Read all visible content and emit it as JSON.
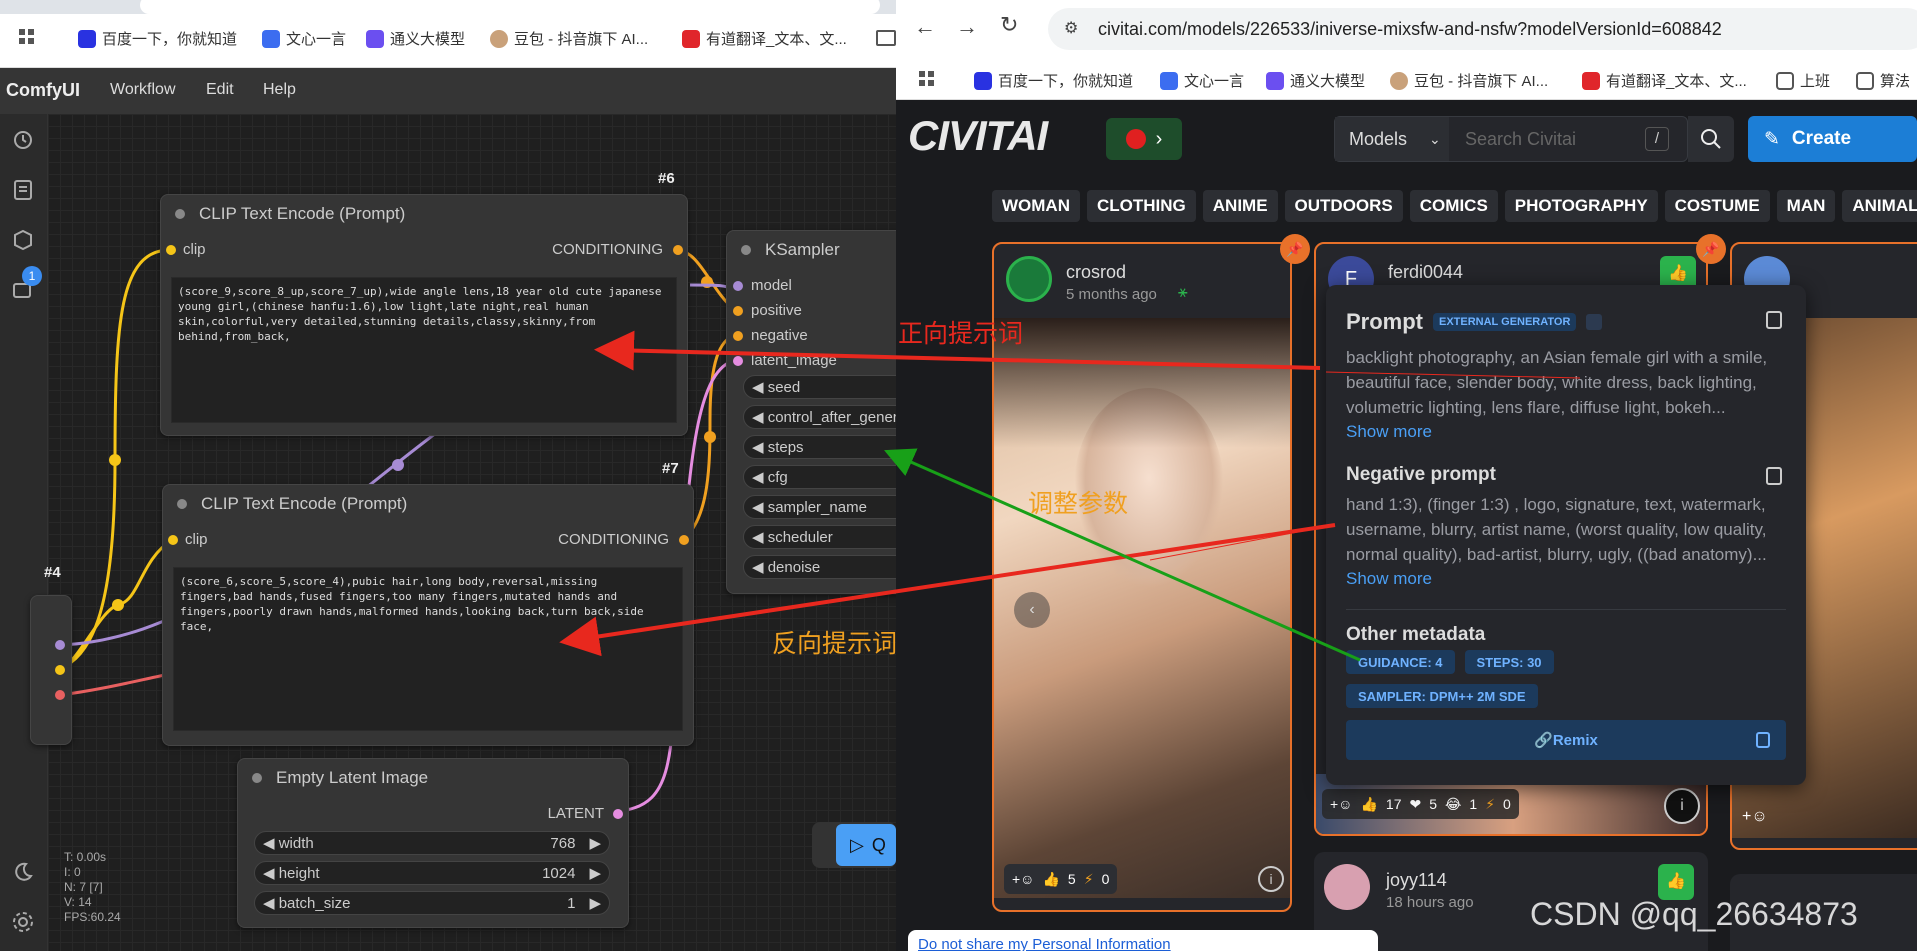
{
  "left_window": {
    "bookmarks": [
      "百度一下，你就知道",
      "文心一言",
      "通义大模型",
      "豆包 - 抖音旗下 AI...",
      "有道翻译_文本、文..."
    ],
    "app_title": "ComfyUI",
    "menu": [
      "Workflow",
      "Edit",
      "Help"
    ],
    "sidebar_badge": "1",
    "nodes": {
      "clip_pos": {
        "badge": "#6",
        "title": "CLIP Text Encode (Prompt)",
        "input": "clip",
        "output": "CONDITIONING",
        "text": "(score_9,score_8_up,score_7_up),wide angle lens,18 year old cute japanese young girl,(chinese hanfu:1.6),low light,late night,real human skin,colorful,very detailed,stunning details,classy,skinny,from behind,from_back,"
      },
      "clip_neg": {
        "badge": "#7",
        "title": "CLIP Text Encode (Prompt)",
        "input": "clip",
        "output": "CONDITIONING",
        "text": "(score_6,score_5,score_4),pubic hair,long body,reversal,missing fingers,bad hands,fused fingers,too many fingers,mutated hands and fingers,poorly drawn hands,malformed hands,looking back,turn back,side face,"
      },
      "ksampler": {
        "title": "KSampler",
        "inputs": [
          "model",
          "positive",
          "negative",
          "latent_image"
        ],
        "widgets": [
          "seed",
          "control_after_gener",
          "steps",
          "cfg",
          "sampler_name",
          "scheduler",
          "denoise"
        ]
      },
      "latent": {
        "title": "Empty Latent Image",
        "output": "LATENT",
        "widgets": [
          {
            "label": "width",
            "value": "768"
          },
          {
            "label": "height",
            "value": "1024"
          },
          {
            "label": "batch_size",
            "value": "1"
          }
        ]
      },
      "node4_badge": "#4"
    },
    "stats": [
      "T: 0.00s",
      "I: 0",
      "N: 7 [7]",
      "V: 14",
      "FPS:60.24"
    ],
    "queue_button": "Q"
  },
  "right_window": {
    "url": "civitai.com/models/226533/iniverse-mixsfw-and-nsfw?modelVersionId=608842",
    "bookmarks": [
      "百度一下，你就知道",
      "文心一言",
      "通义大模型",
      "豆包 - 抖音旗下 AI...",
      "有道翻译_文本、文...",
      "上班",
      "算法"
    ],
    "logo": "CIVITAI",
    "search": {
      "scope": "Models",
      "placeholder": "Search Civitai",
      "shortcut": "/"
    },
    "create_button": "Create",
    "tags": [
      "WOMAN",
      "CLOTHING",
      "ANIME",
      "OUTDOORS",
      "COMICS",
      "PHOTOGRAPHY",
      "COSTUME",
      "MAN",
      "ANIMAL"
    ],
    "card1": {
      "user": "crosrod",
      "time": "5 months ago",
      "likes": "5",
      "bolts": "0"
    },
    "card2": {
      "user": "ferdi0044",
      "likes": "17",
      "hearts": "5",
      "laughs": "1",
      "bolts": "0"
    },
    "card3": {
      "user": "joyy114",
      "time": "18 hours ago"
    },
    "popup": {
      "prompt_title": "Prompt",
      "external_badge": "EXTERNAL GENERATOR",
      "prompt_text": "backlight photography, an Asian female girl with a smile, beautiful face, slender body, white dress, back lighting, volumetric lighting, lens flare, diffuse light, bokeh...",
      "show_more": "Show more",
      "neg_title": "Negative prompt",
      "neg_text": "hand 1:3), (finger 1:3) , logo, signature, text, watermark, username, blurry, artist name, (worst quality, low quality, normal quality), bad-artist, blurry, ugly, ((bad anatomy)...",
      "meta_title": "Other metadata",
      "meta": [
        "GUIDANCE: 4",
        "STEPS: 30",
        "SAMPLER: DPM++ 2M SDE"
      ],
      "remix": "Remix"
    },
    "footer_link": "Do not share my Personal Information"
  },
  "annotations": {
    "positive": "正向提示词",
    "params": "调整参数",
    "negative": "反向提示词",
    "colors": {
      "positive": "#e8281e",
      "params": "#f0a020",
      "negative": "#f0a020"
    }
  },
  "watermark": "CSDN @qq_26634873"
}
